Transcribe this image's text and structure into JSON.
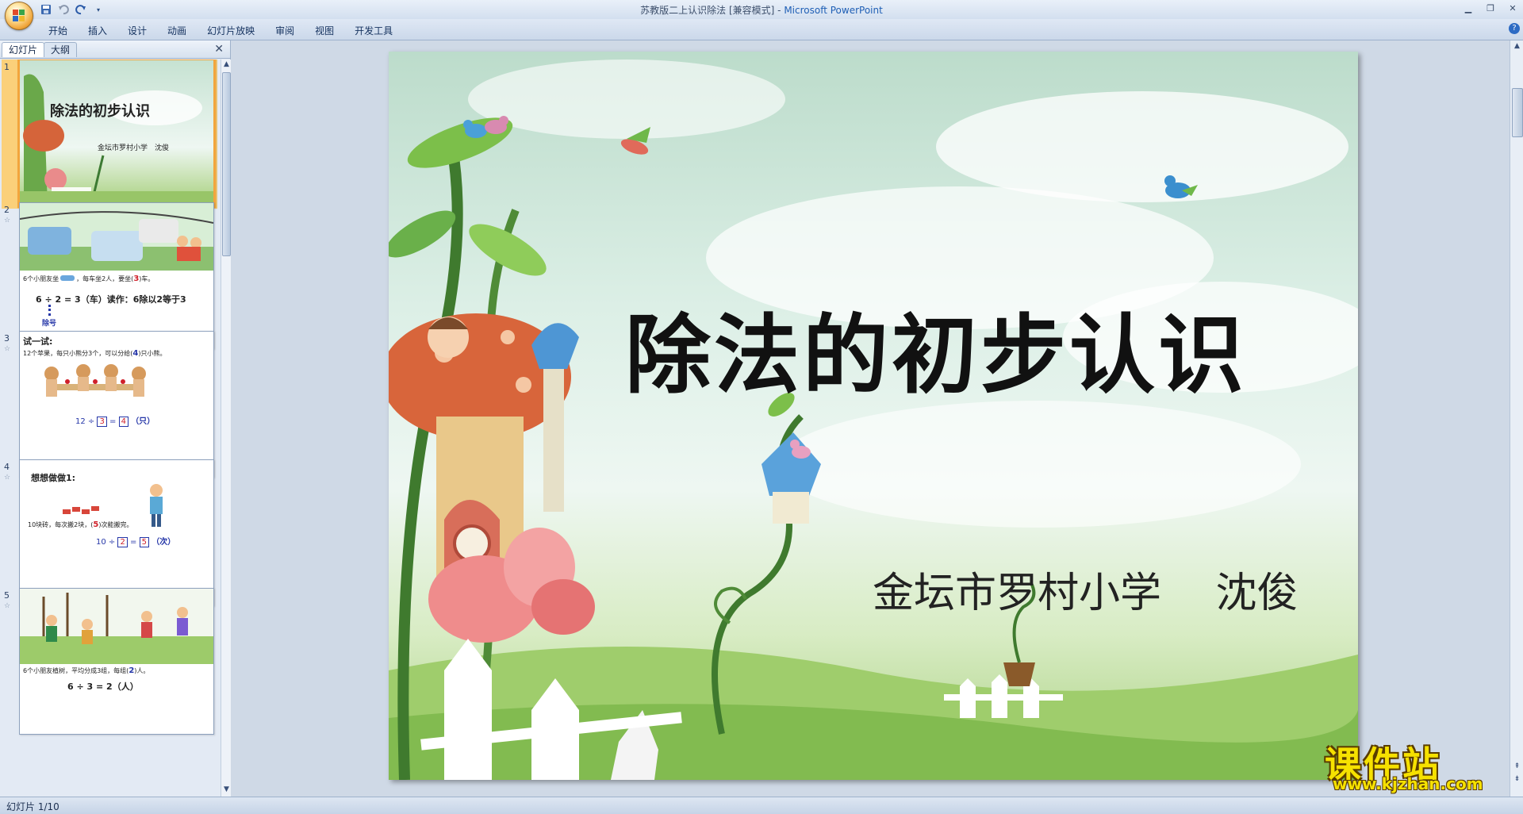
{
  "window": {
    "title": "苏教版二上认识除法 [兼容模式] - ",
    "app_name": "Microsoft PowerPoint"
  },
  "quick_access": {
    "save_icon": "save-icon",
    "undo_icon": "undo-icon",
    "redo_icon": "redo-icon",
    "customize_icon": "dropdown-icon"
  },
  "ribbon": {
    "tabs": [
      "开始",
      "插入",
      "设计",
      "动画",
      "幻灯片放映",
      "审阅",
      "视图",
      "开发工具"
    ]
  },
  "panel": {
    "tab_slides": "幻灯片",
    "tab_outline": "大纲"
  },
  "thumbnails": [
    {
      "num": "1",
      "title": "除法的初步认识",
      "subtitle": "金坛市罗村小学　沈俊"
    },
    {
      "num": "2",
      "line1": "6个小朋友坐",
      "line1b": "，每车坐2人，要坐(",
      "answer": "3",
      "line1c": ")车。",
      "formula": "6 ÷ 2 = 3（车）读作：6除以2等于3",
      "label": "除号"
    },
    {
      "num": "3",
      "heading": "试一试:",
      "line1": "12个苹果，每只小熊分3个，可以分给(",
      "answer": "4",
      "line1c": ")只小熊。",
      "formula_a": "12 ÷",
      "box1": "3",
      "eq": "=",
      "box2": "4",
      "unit": "（只）"
    },
    {
      "num": "4",
      "heading": "想想做做1:",
      "line1": "10块砖，每次搬2块，(",
      "answer": "5",
      "line1c": ")次能搬完。",
      "formula_a": "10 ÷",
      "box1": "2",
      "eq": "=",
      "box2": "5",
      "unit": "（次）"
    },
    {
      "num": "5",
      "line1": "6个小朋友植树，平均分成3组，每组(",
      "answer": "2",
      "line1c": ")人。",
      "formula": "6 ÷ 3 = 2（人）"
    }
  ],
  "slide": {
    "title": "除法的初步认识",
    "subtitle": "金坛市罗村小学　 沈俊"
  },
  "watermark": {
    "brand": "课件站",
    "url": "www.kjzhan.com"
  },
  "status": {
    "slide_indicator": "幻灯片 1/10"
  },
  "colors": {
    "selection": "#f3a53c",
    "ribbon": "#d3dfef",
    "accent_red": "#d0202a",
    "accent_blue": "#2536a8"
  }
}
